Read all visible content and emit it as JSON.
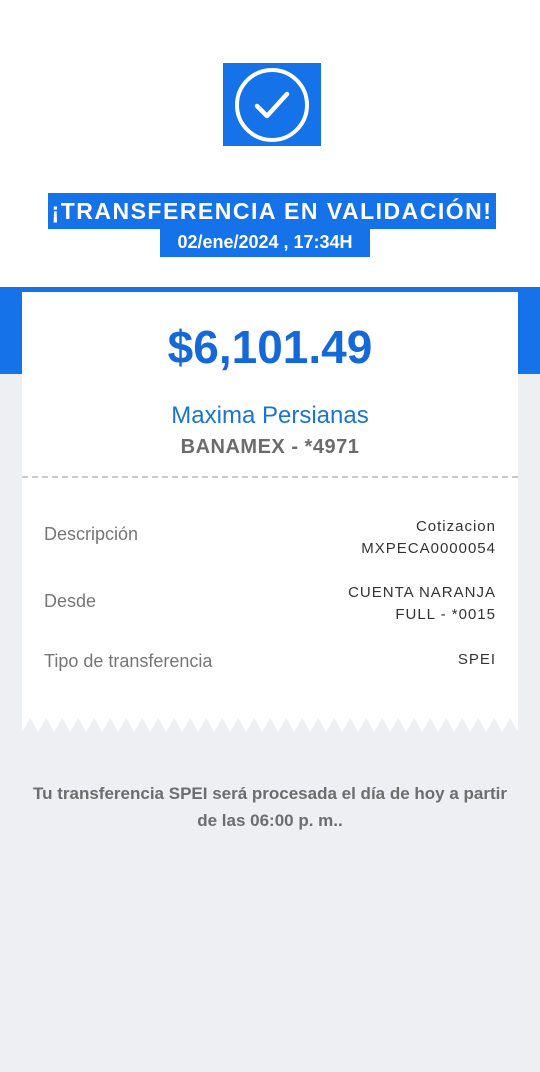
{
  "header": {
    "title": "¡TRANSFERENCIA EN VALIDACIÓN!",
    "datetime": "02/ene/2024 , 17:34H",
    "status_icon": "check-circle-icon"
  },
  "receipt": {
    "amount": "$6,101.49",
    "recipient_name": "Maxima Persianas",
    "recipient_account": "BANAMEX - *4971",
    "details": [
      {
        "label": "Descripción",
        "value_line1": "Cotizacion",
        "value_line2": "MXPECA0000054"
      },
      {
        "label": "Desde",
        "value_line1": "CUENTA NARANJA",
        "value_line2": "FULL - *0015"
      },
      {
        "label": "Tipo de transferencia",
        "value_line1": "SPEI",
        "value_line2": ""
      }
    ]
  },
  "notice": "Tu transferencia SPEI será procesada el día de hoy a partir de las 06:00 p. m..",
  "colors": {
    "accent": "#1572e8",
    "amount": "#1468d8",
    "background": "#eeeff3"
  }
}
